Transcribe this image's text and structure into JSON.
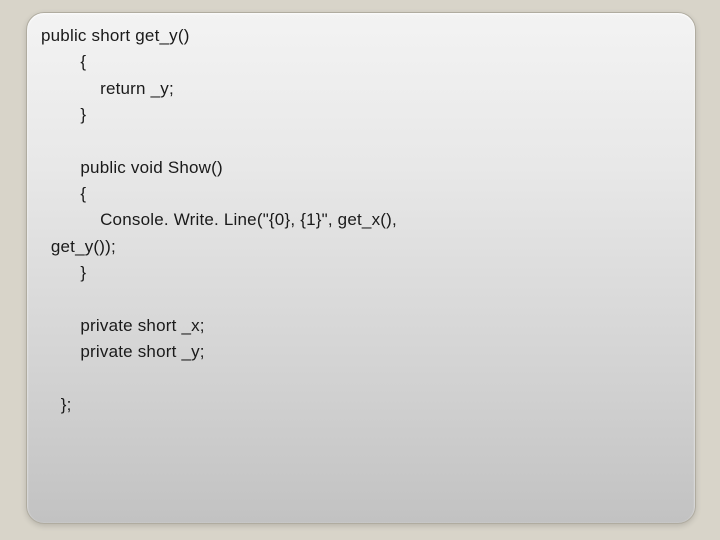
{
  "slide": {
    "code": "public short get_y()\n        {\n            return _y;\n        }\n\n        public void Show()\n        {\n            Console. Write. Line(\"{0}, {1}\", get_x(),\n  get_y());\n        }\n\n        private short _x;\n        private short _y;\n\n    };"
  }
}
